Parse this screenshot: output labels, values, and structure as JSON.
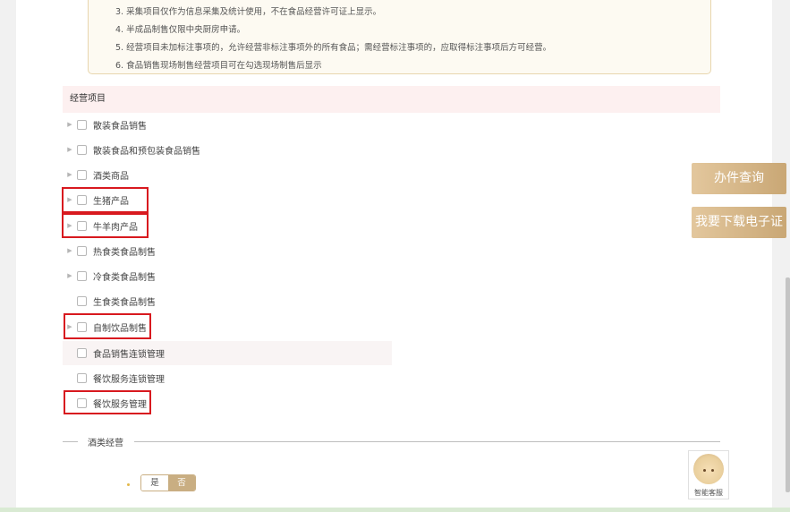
{
  "notes": [
    "3. 采集项目仅作为信息采集及统计使用，不在食品经营许可证上显示。",
    "4. 半成品制售仅限中央厨房申请。",
    "5. 经营项目未加标注事项的，允许经营非标注事项外的所有食品；需经营标注事项的，应取得标注事项后方可经营。",
    "6. 食品销售现场制售经营项目可在勾选现场制售后显示"
  ],
  "section_title": "经营项目",
  "items": [
    {
      "label": "散装食品销售",
      "expandable": true
    },
    {
      "label": "散装食品和预包装食品销售",
      "expandable": true
    },
    {
      "label": "酒类商品",
      "expandable": true
    },
    {
      "label": "生猪产品",
      "expandable": true
    },
    {
      "label": "牛羊肉产品",
      "expandable": true
    },
    {
      "label": "热食类食品制售",
      "expandable": true
    },
    {
      "label": "冷食类食品制售",
      "expandable": true
    },
    {
      "label": "生食类食品制售",
      "expandable": false
    },
    {
      "label": "自制饮品制售",
      "expandable": true
    },
    {
      "label": "食品销售连锁管理",
      "expandable": false
    },
    {
      "label": "餐饮服务连锁管理",
      "expandable": false
    },
    {
      "label": "餐饮服务管理",
      "expandable": false
    }
  ],
  "liquor_section": "酒类经营",
  "toggle": {
    "yes": "是",
    "no": "否",
    "selected": "否"
  },
  "side_buttons": {
    "query": "办件查询",
    "download": "我要下载电子证"
  },
  "customer_service": {
    "label": "智能客服"
  },
  "colors": {
    "accent": "#c9ae82",
    "highlight_border": "#d8191f",
    "section_bg": "#fdf0f0"
  }
}
